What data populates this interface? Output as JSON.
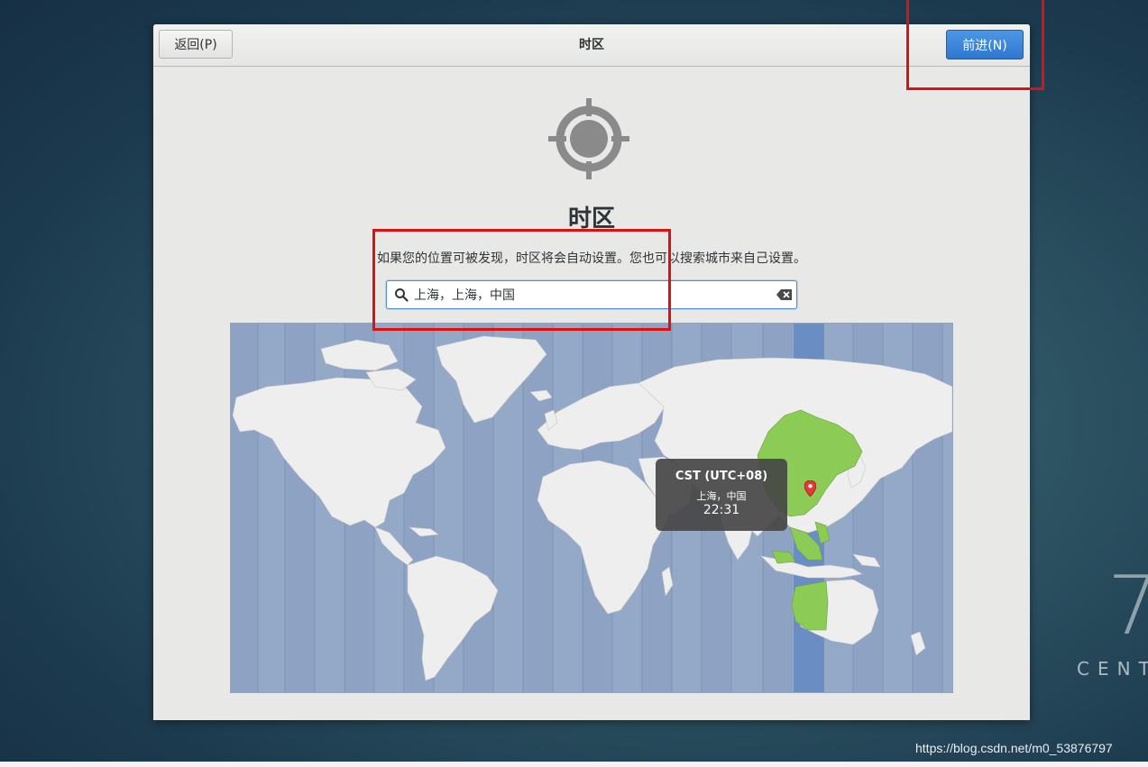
{
  "header": {
    "back_label": "返回(P)",
    "title": "时区",
    "next_label": "前进(N)"
  },
  "page": {
    "icon": "location-target-icon",
    "heading": "时区",
    "description": "如果您的位置可被发现，时区将会自动设置。您也可以搜索城市来自己设置。"
  },
  "search": {
    "value": "上海，上海，中国",
    "search_icon": "search-icon",
    "clear_icon": "clear-text-icon"
  },
  "map": {
    "selected_timezone": {
      "abbreviation": "CST (UTC+08)",
      "location": "上海，中国",
      "time": "22:31"
    }
  },
  "desktop": {
    "brand_number": "7",
    "brand_text": "CENT",
    "watermark": "https://blog.csdn.net/m0_53876797"
  },
  "colors": {
    "highlight_box": "#e01010",
    "primary_button": "#3580db",
    "ocean": "#94a8c8",
    "selected_zone_band": "#6a8ec4",
    "selected_land": "#8dcb57",
    "land": "#eeeeee"
  }
}
